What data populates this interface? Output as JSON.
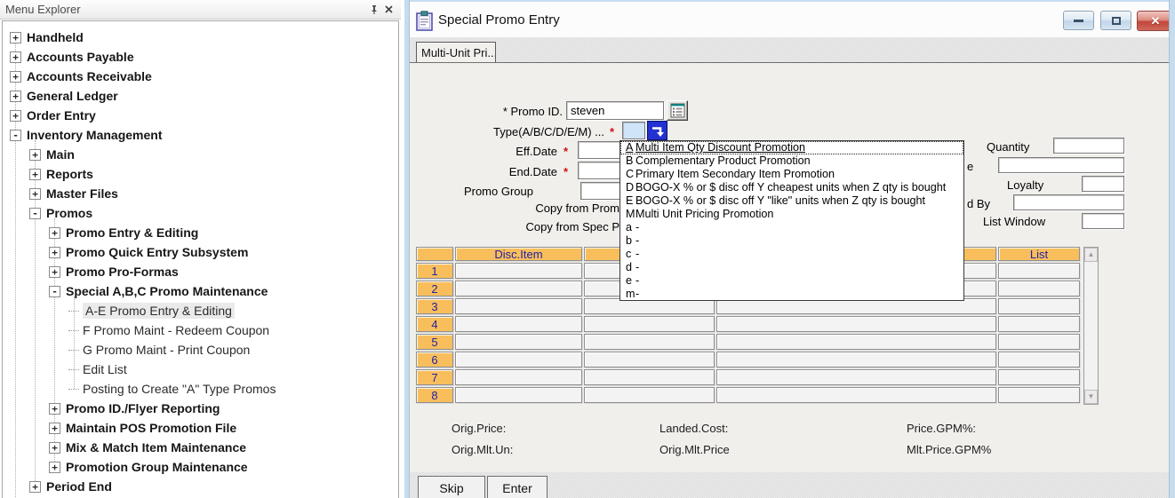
{
  "menu_explorer": {
    "title": "Menu Explorer",
    "items": [
      {
        "label": "Handheld",
        "glyph": "+"
      },
      {
        "label": "Accounts Payable",
        "glyph": "+"
      },
      {
        "label": "Accounts Receivable",
        "glyph": "+"
      },
      {
        "label": "General Ledger",
        "glyph": "+"
      },
      {
        "label": "Order Entry",
        "glyph": "+"
      },
      {
        "label": "Inventory Management",
        "glyph": "-"
      },
      {
        "label": "Main",
        "glyph": "+"
      },
      {
        "label": "Reports",
        "glyph": "+"
      },
      {
        "label": "Master Files",
        "glyph": "+"
      },
      {
        "label": "Promos",
        "glyph": "-"
      },
      {
        "label": "Promo Entry & Editing",
        "glyph": "+"
      },
      {
        "label": "Promo Quick Entry Subsystem",
        "glyph": "+"
      },
      {
        "label": "Promo Pro-Formas",
        "glyph": "+"
      },
      {
        "label": "Special A,B,C Promo Maintenance",
        "glyph": "-"
      },
      {
        "label": "A-E Promo Entry & Editing",
        "glyph": ""
      },
      {
        "label": "F Promo Maint - Redeem Coupon",
        "glyph": ""
      },
      {
        "label": "G Promo Maint - Print Coupon",
        "glyph": ""
      },
      {
        "label": "Edit List",
        "glyph": ""
      },
      {
        "label": "Posting to Create \"A\" Type Promos",
        "glyph": ""
      },
      {
        "label": "Promo ID./Flyer Reporting",
        "glyph": "+"
      },
      {
        "label": "Maintain POS Promotion File",
        "glyph": "+"
      },
      {
        "label": "Mix & Match Item Maintenance",
        "glyph": "+"
      },
      {
        "label": "Promotion Group Maintenance",
        "glyph": "+"
      },
      {
        "label": "Period End",
        "glyph": "+"
      }
    ]
  },
  "window": {
    "title": "Special Promo Entry",
    "tab": "Multi-Unit Pri...",
    "close_glyph": "✕",
    "form": {
      "promo_id_label": "* Promo ID.",
      "promo_id_value": "steven",
      "type_label": "Type(A/B/C/D/E/M) ...",
      "required_marker": "*",
      "eff_date_label": "Eff.Date",
      "end_date_label": "End.Date",
      "promo_group_label": "Promo Group",
      "copy_promo_label": "Copy from Prom",
      "copy_spec_label": "Copy from Spec P"
    },
    "side_fields": {
      "quantity_label": "Quantity",
      "partial_label_1": "e",
      "loyalty_label": "Loyalty",
      "partial_label_2": "d By",
      "list_window_label": "List Window"
    },
    "dropdown": {
      "items": [
        {
          "code": "A",
          "label": "Multi Item Qty Discount Promotion"
        },
        {
          "code": "B",
          "label": "Complementary Product Promotion"
        },
        {
          "code": "C",
          "label": "Primary Item Secondary Item Promotion"
        },
        {
          "code": "D",
          "label": "BOGO-X % or $ disc off Y cheapest units when Z qty is bought"
        },
        {
          "code": "E",
          "label": "BOGO-X % or $ disc off Y \"like\" units when Z qty is bought"
        },
        {
          "code": "M",
          "label": "Multi Unit Pricing Promotion"
        },
        {
          "code": "a",
          "label": "-"
        },
        {
          "code": "b",
          "label": "-"
        },
        {
          "code": "c",
          "label": "-"
        },
        {
          "code": "d",
          "label": "-"
        },
        {
          "code": "e",
          "label": "-"
        },
        {
          "code": "m",
          "label": "-"
        }
      ]
    },
    "grid": {
      "headers": [
        "",
        "Disc.Item",
        "",
        "",
        "List"
      ],
      "row_numbers": [
        "1",
        "2",
        "3",
        "4",
        "5",
        "6",
        "7",
        "8"
      ]
    },
    "scrollbar": {
      "up_glyph": "▲",
      "down_glyph": "▼"
    },
    "summary": {
      "orig_price": "Orig.Price:",
      "landed_cost": "Landed.Cost:",
      "price_gpm": "Price.GPM%:",
      "orig_mlt_un": "Orig.Mlt.Un:",
      "orig_mlt_price": "Orig.Mlt.Price",
      "mlt_price_gpm": "Mlt.Price.GPM%"
    },
    "buttons": {
      "skip": "Skip",
      "enter": "Enter"
    }
  },
  "colors": {
    "grid_header_bg": "#F9BE5C",
    "grid_header_text": "#2121A3",
    "type_field_bg": "#CFE4F7",
    "required_red": "#CF1010",
    "window_border_blue": "#C6DDF0",
    "close_button_red": "#C2463A"
  }
}
